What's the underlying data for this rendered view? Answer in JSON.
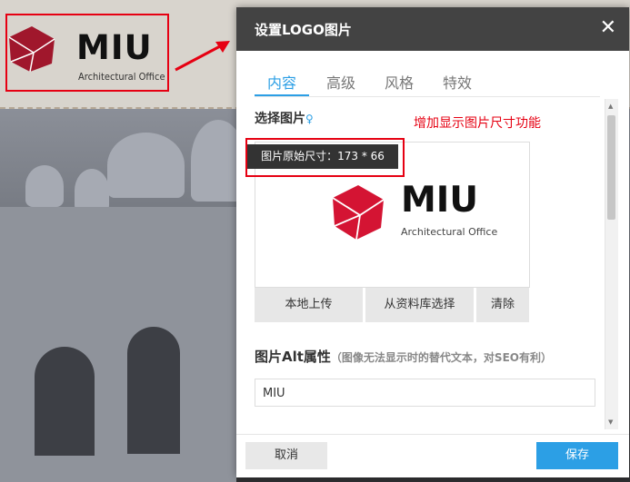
{
  "background_logo": {
    "title": "MIU",
    "subtitle": "Architectural Office"
  },
  "dialog": {
    "title": "设置LOGO图片",
    "tabs": [
      {
        "label": "内容",
        "active": true
      },
      {
        "label": "高级",
        "active": false
      },
      {
        "label": "风格",
        "active": false
      },
      {
        "label": "特效",
        "active": false
      }
    ],
    "select_image_label": "选择图片",
    "annotation_note": "增加显示图片尺寸功能",
    "size_tooltip": "图片原始尺寸：173 * 66",
    "preview_logo": {
      "title": "MIU",
      "subtitle": "Architectural Office"
    },
    "buttons": {
      "upload": "本地上传",
      "library": "从资料库选择",
      "clear": "清除"
    },
    "alt_label": "图片Alt属性",
    "alt_hint": "（图像无法显示时的替代文本，对SEO有利）",
    "alt_value": "MIU",
    "footer": {
      "cancel": "取消",
      "save": "保存"
    }
  },
  "colors": {
    "accent": "#2c9fe5",
    "header": "#434343",
    "annotation_red": "#e60012",
    "logo_red": "#d41433"
  },
  "icons": {
    "close": "close-icon",
    "hint": "lightbulb-icon",
    "arrow": "red-arrow-icon"
  }
}
